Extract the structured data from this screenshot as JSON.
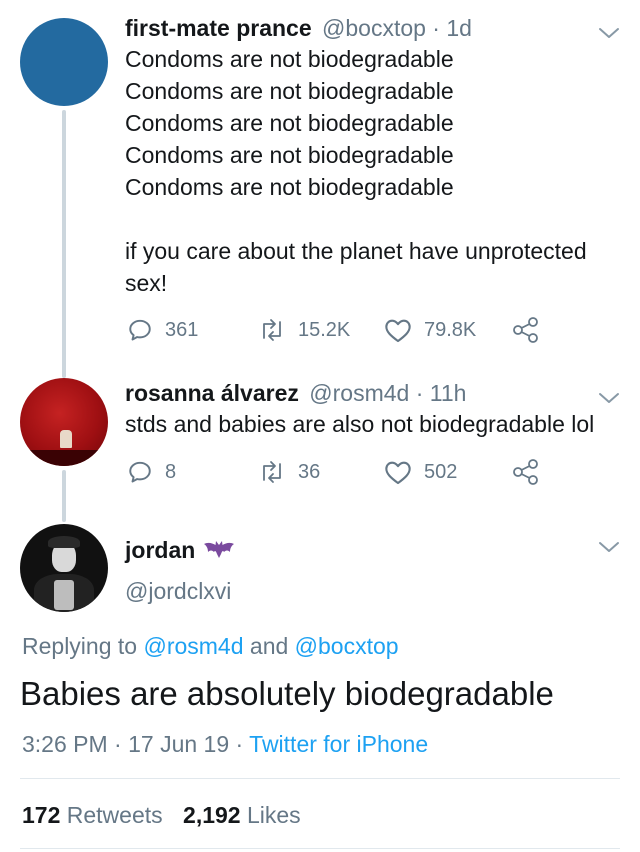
{
  "tweet1": {
    "display_name": "first-mate prance",
    "handle": "@bocxtop",
    "separator": " · ",
    "time": "1d",
    "lines": [
      "Condoms are not biodegradable",
      "Condoms are not biodegradable",
      "Condoms are not biodegradable",
      "Condoms are not biodegradable",
      "Condoms are not biodegradable"
    ],
    "paragraph2": "if you care about the planet have unprotected sex!",
    "replies": "361",
    "retweets": "15.2K",
    "likes": "79.8K",
    "avatar_color": "#236aa0"
  },
  "tweet2": {
    "display_name": "rosanna álvarez",
    "handle": "@rosm4d",
    "separator": " · ",
    "time": "11h",
    "text": "stds and babies are also not biodegradable lol",
    "replies": "8",
    "retweets": "36",
    "likes": "502"
  },
  "main_tweet": {
    "display_name": "jordan",
    "handle": "@jordclxvi",
    "replying_prefix": "Replying to ",
    "reply_mention_1": "@rosm4d",
    "reply_and": " and ",
    "reply_mention_2": "@bocxtop",
    "text": "Babies are absolutely biodegradable",
    "time": "3:26 PM",
    "separator": " · ",
    "date": "17 Jun 19",
    "separator2": " · ",
    "source": "Twitter for iPhone",
    "retweet_count": "172",
    "retweet_label": " Retweets",
    "like_count": "2,192",
    "like_label": " Likes"
  },
  "colors": {
    "link": "#1da1f2",
    "secondary_text": "#657786",
    "thread_line": "#ccd6dd"
  },
  "icons": [
    "reply-icon",
    "retweet-icon",
    "like-icon",
    "share-icon",
    "chevron-down-icon",
    "bat-emoji-icon"
  ]
}
